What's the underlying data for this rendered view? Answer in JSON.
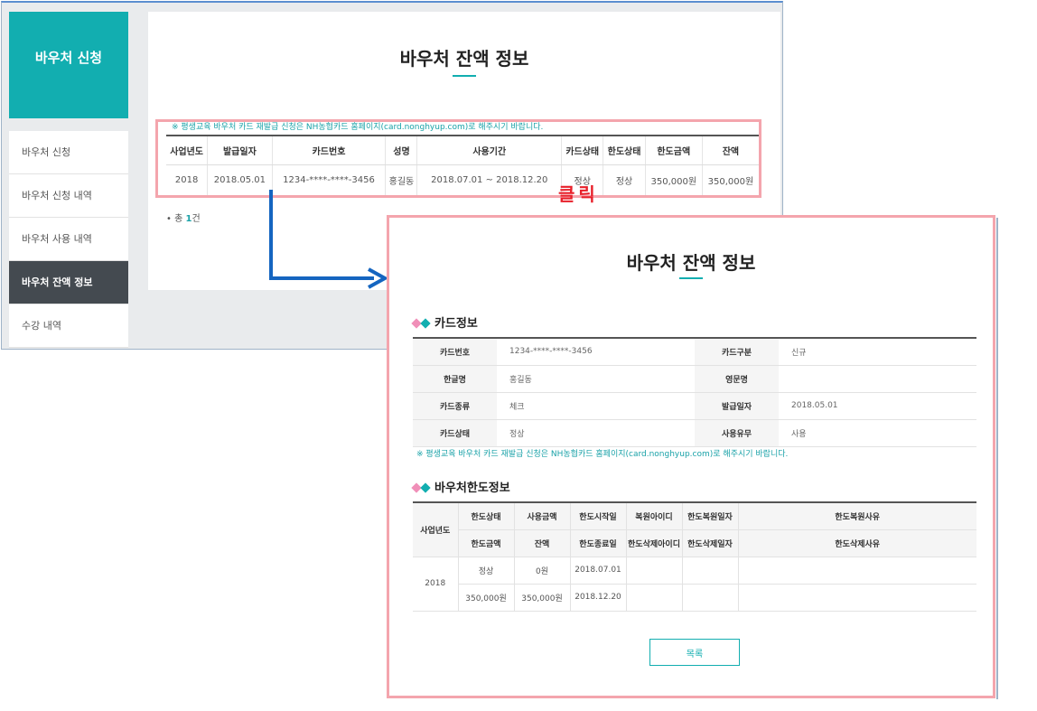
{
  "sidebar": {
    "header_title": "바우처 신청",
    "items": [
      {
        "label": "바우처 신청"
      },
      {
        "label": "바우처 신청 내역"
      },
      {
        "label": "바우처 사용 내역"
      },
      {
        "label": "바우처 잔액 정보"
      },
      {
        "label": "수강 내역"
      }
    ]
  },
  "main": {
    "title": "바우처 잔액 정보",
    "notice": "※ 평생교육 바우처 카드 재발급 신청은 NH농협카드 홈페이지(card.nonghyup.com)로 해주시기 바랍니다.",
    "table": {
      "headers": [
        "사업년도",
        "발급일자",
        "카드번호",
        "성명",
        "사용기간",
        "카드상태",
        "한도상태",
        "한도금액",
        "잔액"
      ],
      "row": [
        "2018",
        "2018.05.01",
        "1234-****-****-3456",
        "홍길동",
        "2018.07.01 ~ 2018.12.20",
        "정상",
        "정상",
        "350,000원",
        "350,000원"
      ]
    },
    "total_prefix": "• 총 ",
    "total_count": "1",
    "total_suffix": "건"
  },
  "annotation": {
    "click_label": "클릭"
  },
  "popup": {
    "title": "바우처 잔액 정보",
    "card_section_title": "카드정보",
    "card_rows": [
      {
        "l1": "카드번호",
        "v1": "1234-****-****-3456",
        "l2": "카드구분",
        "v2": "신규"
      },
      {
        "l1": "한글명",
        "v1": "홍길동",
        "l2": "영문명",
        "v2": ""
      },
      {
        "l1": "카드종류",
        "v1": "체크",
        "l2": "발급일자",
        "v2": "2018.05.01"
      },
      {
        "l1": "카드상태",
        "v1": "정상",
        "l2": "사용유무",
        "v2": "사용"
      }
    ],
    "notice": "※ 평생교육 바우처 카드 재발급 신청은 NH농협카드 홈페이지(card.nonghyup.com)로 해주시기 바랍니다.",
    "limit_section_title": "바우처한도정보",
    "limit_headers_row1": [
      "사업년도",
      "한도상태",
      "사용금액",
      "한도시작일",
      "복원아이디",
      "한도복원일자",
      "한도복원사유"
    ],
    "limit_headers_row2": [
      "한도금액",
      "잔액",
      "한도종료일",
      "한도삭제아이디",
      "한도삭제일자",
      "한도삭제사유"
    ],
    "limit_data_row1": [
      "2018",
      "정상",
      "0원",
      "2018.07.01",
      "",
      "",
      ""
    ],
    "limit_data_row2": [
      "350,000원",
      "350,000원",
      "2018.12.20",
      "",
      "",
      ""
    ],
    "list_button": "목록"
  },
  "colors": {
    "accent": "#12aeb0",
    "highlight": "#f4a5ad",
    "arrow": "#1565c0",
    "click_text": "#e8202a"
  }
}
